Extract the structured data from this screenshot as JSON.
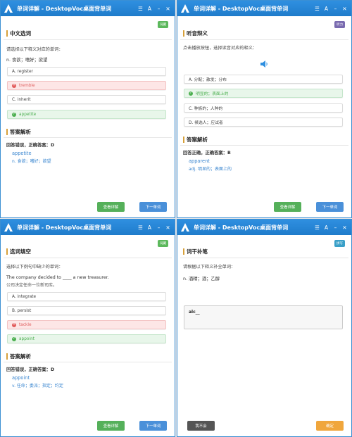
{
  "app_title": "单词详解 - DesktopVoc桌面背单词",
  "colors": {
    "accent": "#1f7ccb",
    "correct": "#4caf50",
    "wrong": "#e25c5c",
    "answer_blue": "#3a86d0"
  },
  "icons": {
    "logo": "app-logo-icon",
    "list": "list-icon",
    "font": "font-size-icon",
    "minimize": "minimize-icon",
    "close": "close-icon",
    "speaker": "speaker-icon"
  },
  "windows": {
    "tl": {
      "badge": "词藏",
      "section": "中文选词",
      "prompt": "请选择以下释义对应的单词：",
      "definition": "n. 食欲；嗜好；欲望",
      "options": [
        {
          "label": "A.  register",
          "state": "normal"
        },
        {
          "label": "tremble",
          "state": "wrong"
        },
        {
          "label": "C.  inherit",
          "state": "normal"
        },
        {
          "label": "appetite",
          "state": "right"
        }
      ],
      "analysis_title": "答案解析",
      "result": "回答错误，正确答案：D",
      "answer_word": "appetite",
      "answer_meaning": "n. 食欲；嗜好；欲望",
      "btn_detail": "查看详解",
      "btn_next": "下一单词"
    },
    "tr": {
      "badge": "听力",
      "section": "听音辩义",
      "prompt": "点击播放按钮，选择读音对应的释义：",
      "options": [
        {
          "label": "A.  分配；散发；分布",
          "state": "normal"
        },
        {
          "label": "明显的；表面上的",
          "state": "right"
        },
        {
          "label": "C.  种族的；人种的",
          "state": "normal"
        },
        {
          "label": "D.  候选人；应试者",
          "state": "normal"
        }
      ],
      "analysis_title": "答案解析",
      "result": "回答正确，正确答案：B",
      "answer_word": "apparent",
      "answer_meaning": "adj. 明显的；表面上的",
      "btn_detail": "查看详解",
      "btn_next": "下一单词"
    },
    "bl": {
      "badge": "词藏",
      "section": "选词填空",
      "prompt": "选择以下例句中缺少的单词：",
      "sentence": "The company decided to ____ a new treasurer.",
      "sentence_cn": "公司决定任命一位新司库。",
      "options": [
        {
          "label": "A.  integrate",
          "state": "normal"
        },
        {
          "label": "B.  persist",
          "state": "normal"
        },
        {
          "label": "tackle",
          "state": "wrong"
        },
        {
          "label": "appoint",
          "state": "right"
        }
      ],
      "analysis_title": "答案解析",
      "result": "回答错误，正确答案：D",
      "answer_word": "appoint",
      "answer_meaning": "v. 任命；委派；指定；约定",
      "btn_detail": "查看详解",
      "btn_next": "下一单词"
    },
    "br": {
      "badge": "拼写",
      "section": "词干补笔",
      "prompt": "请根据以下释义补全单词：",
      "definition": "n. 酒精；酒；乙醇",
      "input_value": "alc__",
      "btn_skip": "我不会",
      "btn_confirm": "确定"
    }
  }
}
